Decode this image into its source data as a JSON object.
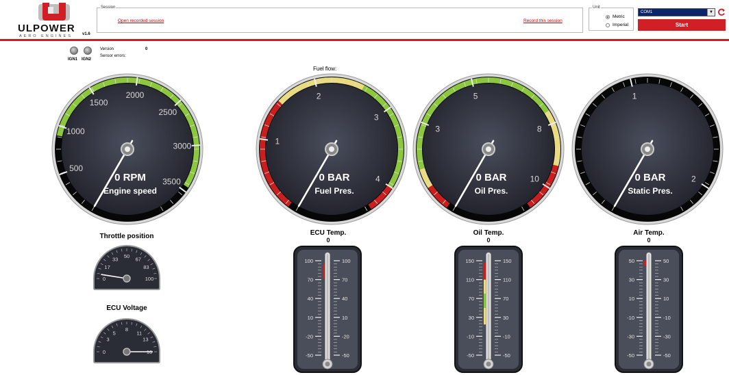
{
  "header": {
    "logo_text": "ULPOWER",
    "logo_sub": "AERO ENGINES",
    "logo_version": "v1.6",
    "session_legend": "Session",
    "open_session": "Open recorded session",
    "record_session": "Record this session",
    "unit_legend": "Unit",
    "unit_metric": "Metric",
    "unit_imperial": "Imperial",
    "unit_selected": "Metric",
    "com_port": "COM1",
    "start_label": "Start"
  },
  "status": {
    "ign1": "IGN1",
    "ign2": "IGN2",
    "version_label": "Version",
    "version_value": "0",
    "sensor_errors_label": "Sensor errors:"
  },
  "fuel_flow_label": "Fuel flow:",
  "gauges": [
    {
      "id": "rpm",
      "unit_text": "0 RPM",
      "name": "Engine speed",
      "value": 0,
      "min": 0,
      "max": 3800,
      "ticks": [
        "500",
        "1000",
        "1500",
        "2000",
        "2500",
        "3000",
        "3500"
      ],
      "tick_values": [
        500,
        1000,
        1500,
        2000,
        2500,
        3000,
        3500
      ],
      "zones": [
        {
          "from": 900,
          "to": 3450,
          "color": "#8dc63f"
        }
      ]
    },
    {
      "id": "fuel",
      "unit_text": "0 BAR",
      "name": "Fuel Pres.",
      "value": 0,
      "min": 0,
      "max": 4.4,
      "ticks": [
        "1",
        "2",
        "3",
        "4"
      ],
      "tick_values": [
        1,
        2,
        3,
        4
      ],
      "zones": [
        {
          "from": 0.1,
          "to": 1.5,
          "color": "#c8201f"
        },
        {
          "from": 1.5,
          "to": 2.6,
          "color": "#e9dc80"
        },
        {
          "from": 2.6,
          "to": 4.0,
          "color": "#8dc63f"
        },
        {
          "from": 4.0,
          "to": 4.35,
          "color": "#c8201f"
        }
      ]
    },
    {
      "id": "oil",
      "unit_text": "0 BAR",
      "name": "Oil Pres.",
      "value": 0,
      "min": 0,
      "max": 11,
      "ticks": [
        "3",
        "5",
        "8",
        "10"
      ],
      "tick_values": [
        3,
        5,
        8,
        10
      ],
      "zones": [
        {
          "from": 0.2,
          "to": 1.0,
          "color": "#c8201f"
        },
        {
          "from": 1.0,
          "to": 1.6,
          "color": "#e9dc80"
        },
        {
          "from": 1.6,
          "to": 7.6,
          "color": "#8dc63f"
        },
        {
          "from": 7.6,
          "to": 9.3,
          "color": "#e9dc80"
        },
        {
          "from": 9.3,
          "to": 10.8,
          "color": "#c8201f"
        }
      ]
    },
    {
      "id": "static",
      "unit_text": "0 BAR",
      "name": "Static Pres.",
      "value": 0,
      "min": 0,
      "max": 2.2,
      "ticks": [
        "1",
        "2"
      ],
      "tick_values": [
        1,
        2
      ],
      "zones": []
    }
  ],
  "small_gauges": [
    {
      "id": "throttle",
      "title": "Throttle position",
      "value": 0,
      "min": 0,
      "max": 100,
      "ticks": [
        "0",
        "17",
        "33",
        "50",
        "67",
        "83",
        "100"
      ],
      "tick_values": [
        0,
        17,
        33,
        50,
        67,
        83,
        100
      ],
      "needle_value": 5
    },
    {
      "id": "ecuv",
      "title": "ECU Voltage",
      "value": 16,
      "min": 0,
      "max": 16,
      "ticks": [
        "0",
        "3",
        "5",
        "8",
        "11",
        "13",
        "16"
      ],
      "tick_values": [
        0,
        3,
        5,
        8,
        11,
        13,
        16
      ],
      "needle_value": 16
    }
  ],
  "thermometers": [
    {
      "id": "ecu",
      "title": "ECU Temp.",
      "value": "0",
      "min": -50,
      "max": 100,
      "ticks": [
        "100",
        "70",
        "40",
        "10",
        "-20",
        "-50"
      ],
      "tick_values": [
        100,
        70,
        40,
        10,
        -20,
        -50
      ],
      "zones": [
        {
          "from": 72,
          "to": 95,
          "color": "#c8201f"
        }
      ]
    },
    {
      "id": "oil",
      "title": "Oil Temp.",
      "value": "0",
      "min": -50,
      "max": 150,
      "ticks": [
        "150",
        "110",
        "70",
        "30",
        "-10",
        "-50"
      ],
      "tick_values": [
        150,
        110,
        70,
        30,
        -10,
        -50
      ],
      "zones": [
        {
          "from": 110,
          "to": 145,
          "color": "#c8201f"
        },
        {
          "from": 80,
          "to": 110,
          "color": "#e9dc80"
        },
        {
          "from": 50,
          "to": 80,
          "color": "#8dc63f"
        },
        {
          "from": 15,
          "to": 50,
          "color": "#e9dc80"
        }
      ]
    },
    {
      "id": "air",
      "title": "Air Temp.",
      "value": "0",
      "min": -50,
      "max": 50,
      "ticks": [
        "50",
        "30",
        "10",
        "-10",
        "-30",
        "-50"
      ],
      "tick_values": [
        50,
        30,
        10,
        -10,
        -30,
        -50
      ],
      "zones": [
        {
          "from": 45,
          "to": 50,
          "color": "#c8201f"
        }
      ]
    }
  ]
}
